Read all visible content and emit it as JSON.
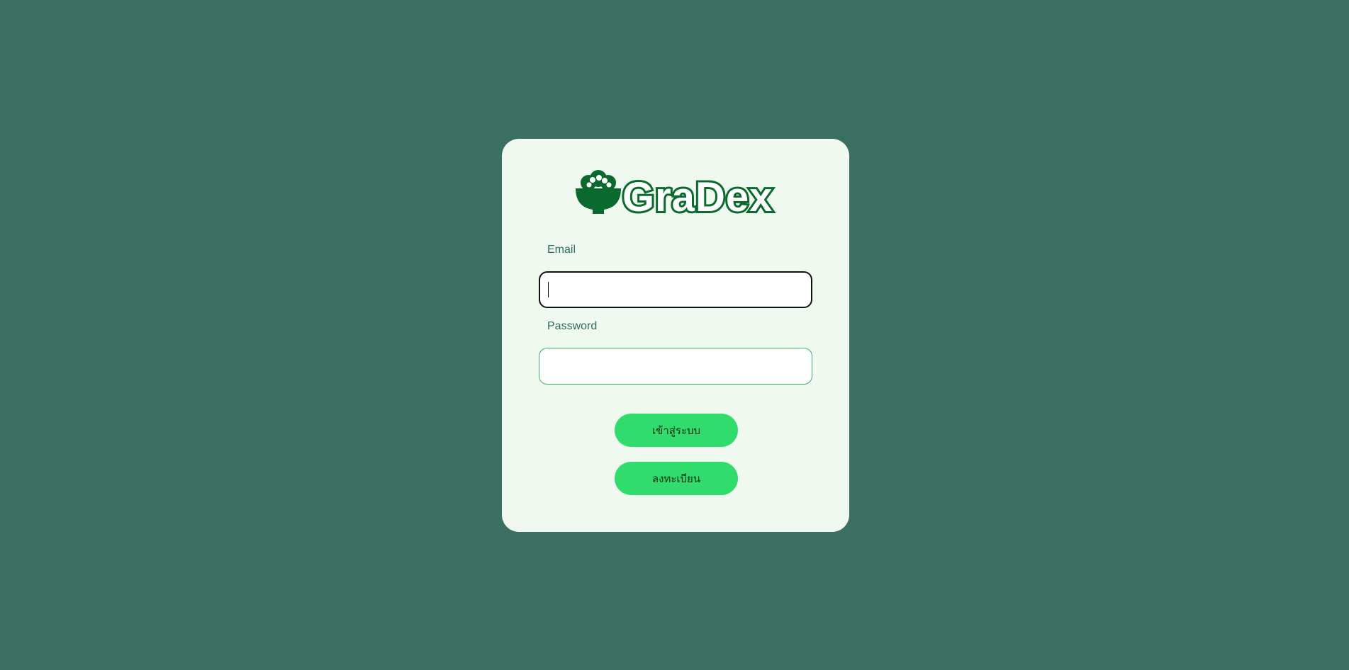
{
  "brand": {
    "name": "GraDex",
    "logo_icon": "rice-bowl-icon",
    "color": "#0a6a2e"
  },
  "form": {
    "email_label": "Email",
    "email_value": "",
    "password_label": "Password",
    "password_value": "",
    "login_button": "เข้าสู่ระบบ",
    "register_button": "ลงทะเบียน"
  },
  "colors": {
    "background": "#3a6f61",
    "card": "#eff9ef",
    "button": "#2fdc6c",
    "label": "#2f6d5b"
  }
}
